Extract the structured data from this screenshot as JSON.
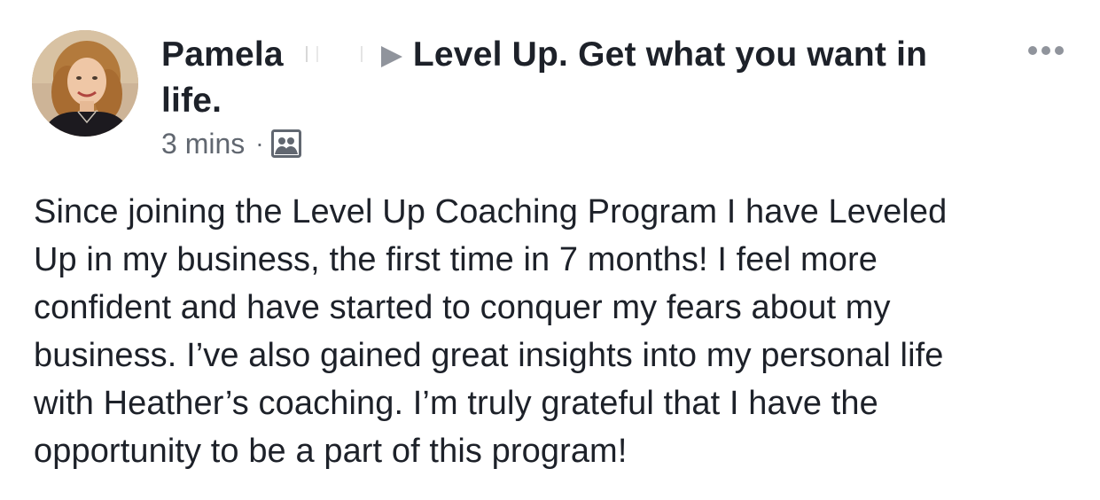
{
  "post": {
    "author": "Pamela",
    "group": "Level Up. Get what you want in",
    "group_cont": "life.",
    "timestamp": "3 mins",
    "separator": "·",
    "audience_icon": "group-audience-icon",
    "more_icon": "more-options-icon",
    "body_lines": [
      "Since joining the Level Up Coaching Program I have Leveled",
      "Up in my business, the first time in 7 months! I feel more",
      "confident and have started to conquer my fears about my",
      "business. I’ve also gained great insights into my personal life",
      "with Heather’s coaching. I’m truly grateful that I have the",
      "opportunity to be a part of this program!"
    ]
  },
  "colors": {
    "text_primary": "#1d2129",
    "text_secondary": "#616770",
    "icon_gray": "#90949c"
  }
}
